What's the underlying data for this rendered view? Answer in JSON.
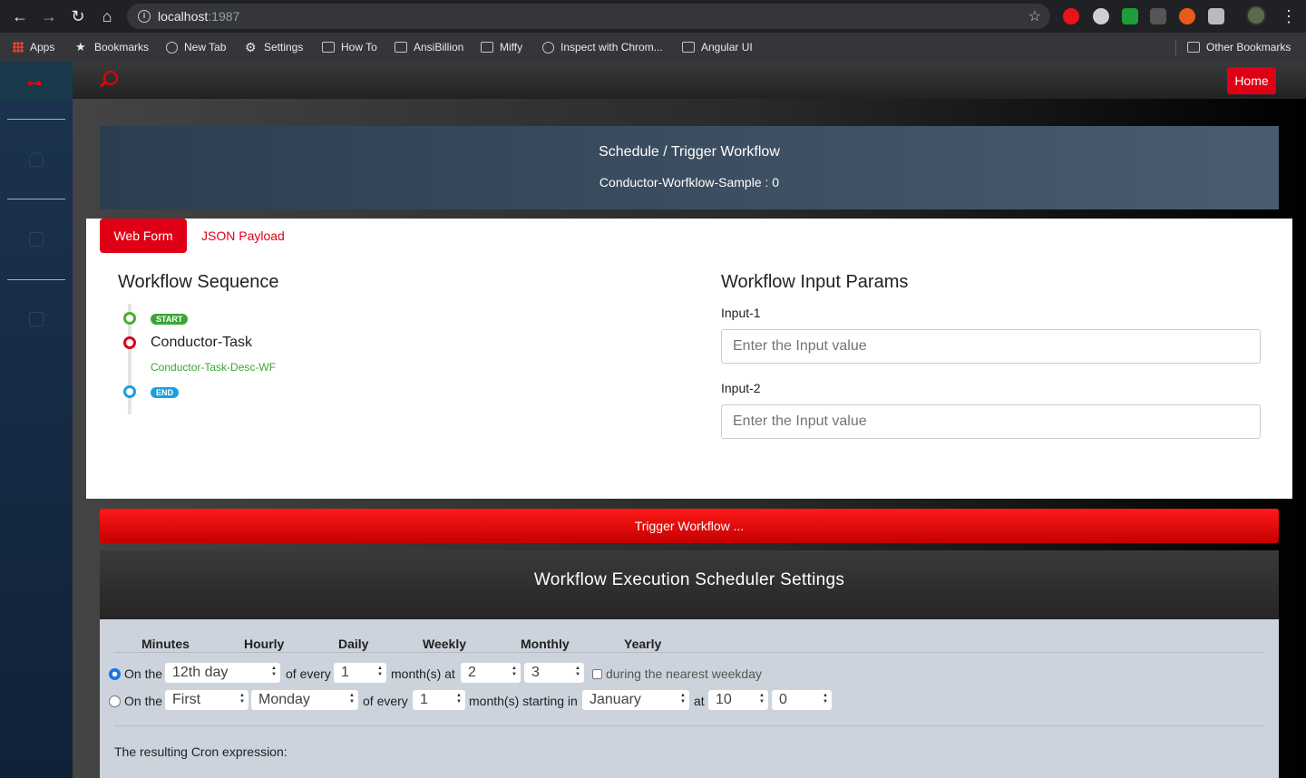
{
  "browser": {
    "url_host": "localhost",
    "url_port": ":1987",
    "bookmarks": [
      "Apps",
      "Bookmarks",
      "New Tab",
      "Settings",
      "How To",
      "AnsiBillion",
      "Miffy",
      "Inspect with Chrom...",
      "Angular UI"
    ],
    "other_bookmarks": "Other Bookmarks"
  },
  "app": {
    "home_label": "Home",
    "hero": {
      "title": "Schedule / Trigger Workflow",
      "subtitle": "Conductor-Worfklow-Sample : 0"
    },
    "tabs": [
      "Web Form",
      "JSON Payload"
    ],
    "sequence": {
      "heading": "Workflow Sequence",
      "start_label": "START",
      "task_name": "Conductor-Task",
      "task_desc": "Conductor-Task-Desc-WF",
      "end_label": "END"
    },
    "params": {
      "heading": "Workflow Input Params",
      "inputs": [
        {
          "label": "Input-1",
          "placeholder": "Enter the Input value"
        },
        {
          "label": "Input-2",
          "placeholder": "Enter the Input value"
        }
      ]
    },
    "trigger_label": "Trigger Workflow ...",
    "scheduler": {
      "title": "Workflow Execution Scheduler Settings",
      "tabs": [
        "Minutes",
        "Hourly",
        "Daily",
        "Weekly",
        "Monthly",
        "Yearly"
      ],
      "row1": {
        "prefix": "On the",
        "day": "12th day",
        "of_every": "of every",
        "months": "1",
        "suffix": "month(s) at",
        "hour": "2",
        "minute": "3",
        "weekday_label": "during the nearest weekday"
      },
      "row2": {
        "prefix": "On the",
        "ordinal": "First",
        "weekday": "Monday",
        "of_every": "of every",
        "months": "1",
        "suffix": "month(s) starting in",
        "start_month": "January",
        "at": "at",
        "hour": "10",
        "minute": "0"
      },
      "result_label": "The resulting Cron expression:"
    }
  },
  "colors": {
    "brand_red": "#e00016",
    "start_green": "#3aa635",
    "end_blue": "#1aa0e0"
  }
}
